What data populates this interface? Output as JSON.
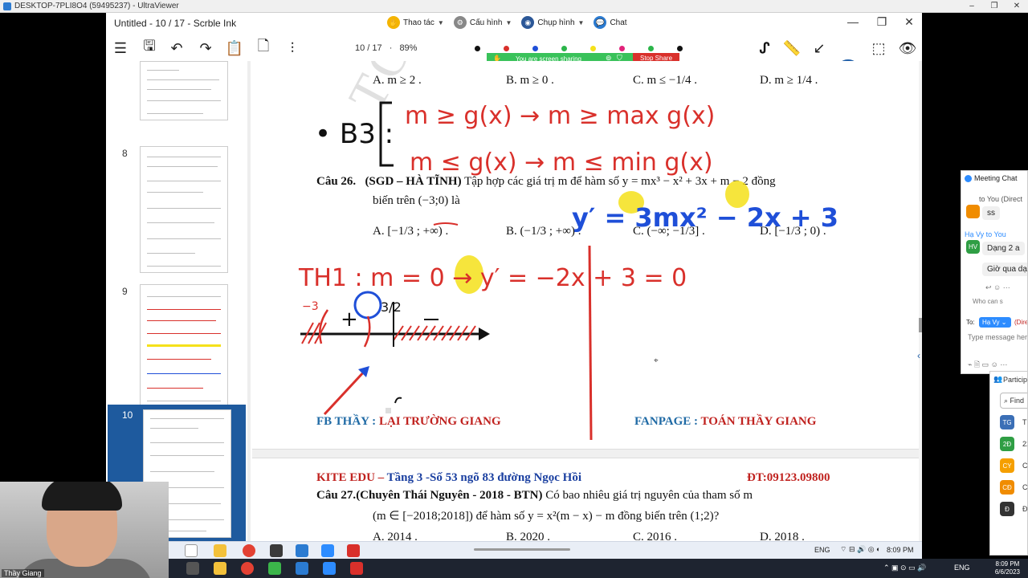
{
  "remote_window": {
    "title": "DESKTOP-7PLI8O4 (59495237) - UltraViewer",
    "min": "–",
    "max": "❐",
    "close": "✕"
  },
  "app": {
    "title": "Untitled - 10 / 17 - Scrble Ink",
    "min": "—",
    "max": "❐",
    "close": "✕"
  },
  "uv_toolbar": {
    "actions": "Thao tác",
    "config": "Cấu hình",
    "screenshot": "Chụp hình",
    "chat": "Chat"
  },
  "toolbar": {
    "page_indicator": "10 / 17",
    "separator": "·",
    "zoom": "89%",
    "pen_colors": [
      "#111111",
      "#d9302b",
      "#1f4fd8",
      "#2bb54a",
      "#f5e11a",
      "#e2227a",
      "#2bb54a",
      "#111111"
    ]
  },
  "share_banner": {
    "message": "You are screen sharing",
    "stop_label": "Stop Share"
  },
  "sidebar": {
    "pages": [
      {
        "number": "8"
      },
      {
        "number": "9"
      },
      {
        "number": "10",
        "selected": true
      }
    ]
  },
  "document": {
    "q25_options": {
      "a": "A. m ≥ 2 .",
      "b": "B. m ≥ 0 .",
      "c": "C. m ≤ −1/4 .",
      "d": "D. m ≥ 1/4 ."
    },
    "q26": {
      "label": "Câu 26.",
      "source": "(SGD – HÀ TĨNH)",
      "text": "Tập hợp các giá trị m để hàm số y = mx³ − x² + 3x + m − 2 đồng",
      "text2": "biến trên (−3;0) là",
      "a": "A. [−1/3 ; +∞) .",
      "b": "B. (−1/3 ; +∞) .",
      "c": "C. (−∞; −1/3] .",
      "d": "D. [−1/3 ; 0) ."
    },
    "footer_fb_prefix": "FB THẦY : ",
    "footer_fb_name": "LẠI TRƯỜNG GIANG",
    "footer_fanpage_prefix": "FANPAGE : ",
    "footer_fanpage_name": "TOÁN THẦY GIANG",
    "header_kite": "KITE EDU – ",
    "header_address": "Tầng 3 -Số 53 ngõ 83 đường Ngọc Hồi",
    "header_phone": "ĐT:09123.09800",
    "q27": {
      "label": "Câu 27.",
      "source": "(Chuyên Thái Nguyên - 2018 - BTN)",
      "text": "Có bao nhiêu giá trị nguyên của tham số m",
      "text2": "(m ∈ [−2018;2018]) để hàm số y = x²(m − x) − m đồng biến trên (1;2)?",
      "a": "A. 2014 .",
      "b": "B. 2020 .",
      "c": "C. 2016 .",
      "d": "D. 2018 ."
    },
    "watermark": "TOÁN THẦY GIANG"
  },
  "ink": {
    "b3": "• B3 :",
    "line1": "m ≥ g(x) → m ≥ max g(x)",
    "line2": "m ≤ g(x) → m ≤ min g(x)",
    "deriv": "y′ = 3mx² − 2x + 3",
    "th1": "TH1 : m = 0 → y′ = −2x + 3 = 0",
    "sign": "+",
    "root": "3/2",
    "minus3": "−3"
  },
  "chat_panel": {
    "title": "Meeting Chat",
    "to_you": "to You (Direct",
    "msg1": "ss",
    "sender2": "Hạ Vy to You",
    "avatar2": "HV",
    "msg2": "Dạng 2 a",
    "msg3": "Giờ qua dạ",
    "who_can": "Who can s",
    "to_label": "To:",
    "to_value": "Hạ Vy ⌄",
    "to_direct": "(Direc",
    "placeholder": "Type message here"
  },
  "participants_panel": {
    "title": "Particip",
    "find": "Find",
    "rows": [
      {
        "initials": "TG",
        "name": "Th",
        "color": "#3b6fb6"
      },
      {
        "initials": "2Đ",
        "name": "22",
        "color": "#2f9e44"
      },
      {
        "initials": "CY",
        "name": "Ch",
        "color": "#f59f00"
      },
      {
        "initials": "CĐ",
        "name": "Cô",
        "color": "#f08c00"
      },
      {
        "initials": "Đ",
        "name": "Đề",
        "color": "#333333"
      }
    ]
  },
  "webcam": {
    "name": "Thầy Giang"
  },
  "remote_taskbar": {
    "lang": "ENG",
    "time": "8:09 PM"
  },
  "local_taskbar": {
    "lang": "ENG",
    "time": "8:09 PM",
    "date": "6/6/2023"
  }
}
